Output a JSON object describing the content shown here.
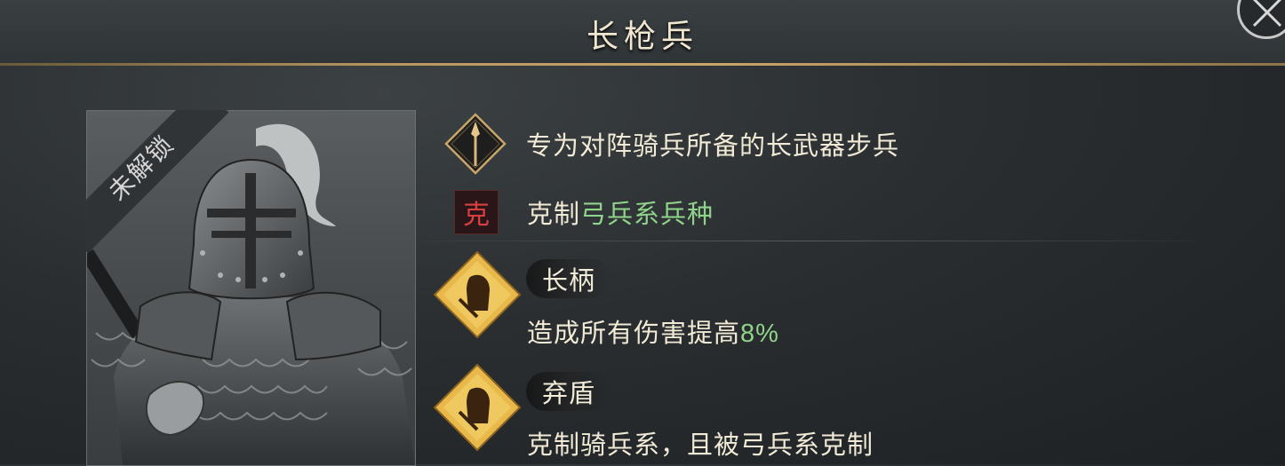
{
  "header": {
    "title": "长枪兵"
  },
  "portrait": {
    "status_label": "未解锁"
  },
  "description": {
    "text": "专为对阵骑兵所备的长武器步兵"
  },
  "counter": {
    "glyph": "克",
    "prefix": "克制",
    "highlight": "弓兵系兵种"
  },
  "skills": [
    {
      "name": "长柄",
      "desc_prefix": "造成所有伤害提高",
      "desc_value": "8%"
    },
    {
      "name": "弃盾",
      "desc": "克制骑兵系，且被弓兵系克制"
    }
  ],
  "colors": {
    "accent_gold": "#c9a56a",
    "highlight_green": "#8fd48a",
    "counter_red": "#d84040",
    "skill_icon_gold": "#e8b84a"
  }
}
